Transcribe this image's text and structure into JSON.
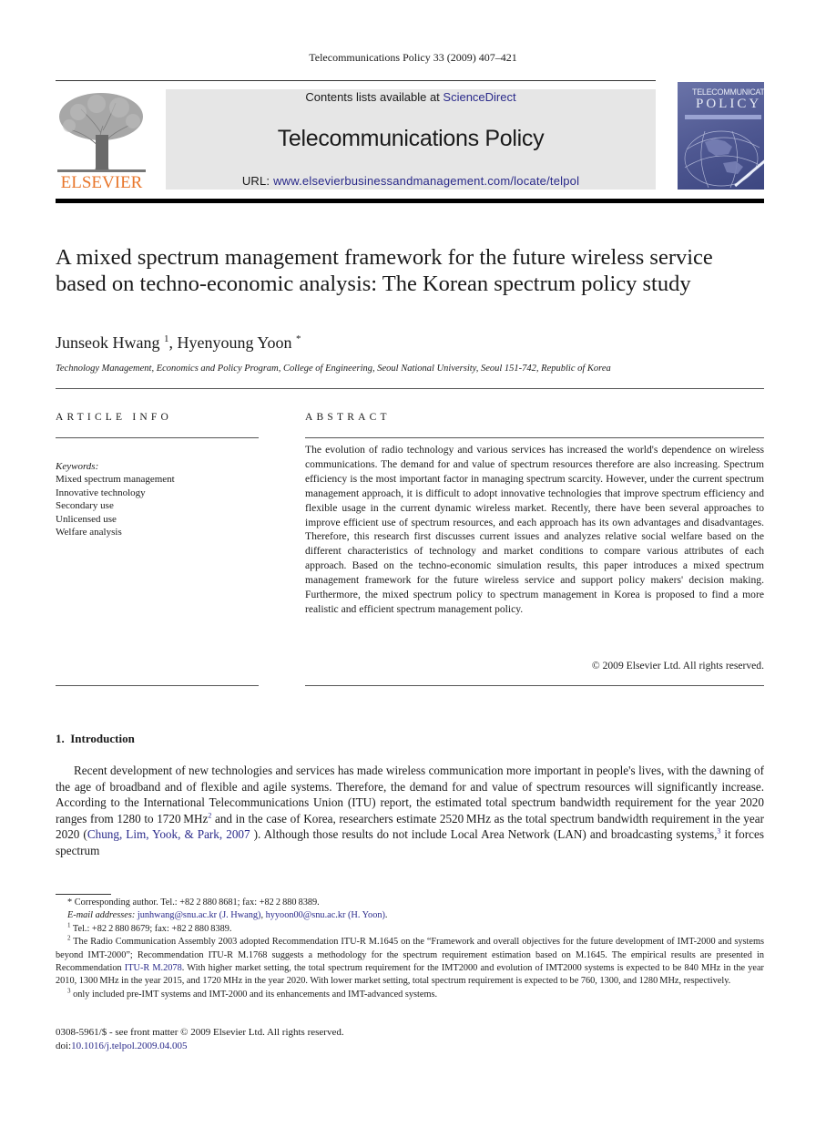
{
  "running_head": "Telecommunications Policy 33 (2009) 407–421",
  "masthead": {
    "contents_prefix": "Contents lists available at ",
    "contents_link": "ScienceDirect",
    "journal_name": "Telecommunications Policy",
    "url_prefix": "URL: ",
    "url": "www.elsevierbusinessandmanagement.com/locate/telpol",
    "publisher_logo_text": "ELSEVIER",
    "cover_title_line1": "TELECOMMUNICATIONS",
    "cover_title_line2": "POLICY"
  },
  "colors": {
    "link": "#2a2a8a",
    "elsevier_orange": "#e8762b",
    "masthead_gray": "#e6e6e6",
    "cover_blue": "#4e5791"
  },
  "article": {
    "title": "A mixed spectrum management framework for the future wireless service based on techno-economic analysis: The Korean spectrum policy study",
    "authors": [
      {
        "name": "Junseok Hwang",
        "mark": "1"
      },
      {
        "name": "Hyenyoung Yoon",
        "mark": "*"
      }
    ],
    "author_separator": ", ",
    "affiliation": "Technology Management, Economics and Policy Program, College of Engineering, Seoul National University, Seoul 151-742, Republic of Korea"
  },
  "article_info": {
    "heading": "ARTICLE INFO",
    "keywords_label": "Keywords:",
    "keywords": [
      "Mixed spectrum management",
      "Innovative technology",
      "Secondary use",
      "Unlicensed use",
      "Welfare analysis"
    ]
  },
  "abstract": {
    "heading": "ABSTRACT",
    "text": "The evolution of radio technology and various services has increased the world's dependence on wireless communications. The demand for and value of spectrum resources therefore are also increasing. Spectrum efficiency is the most important factor in managing spectrum scarcity. However, under the current spectrum management approach, it is difficult to adopt innovative technologies that improve spectrum efficiency and flexible usage in the current dynamic wireless market. Recently, there have been several approaches to improve efficient use of spectrum resources, and each approach has its own advantages and disadvantages. Therefore, this research first discusses current issues and analyzes relative social welfare based on the different characteristics of technology and market conditions to compare various attributes of each approach. Based on the techno-economic simulation results, this paper introduces a mixed spectrum management framework for the future wireless service and support policy makers' decision making. Furthermore, the mixed spectrum policy to spectrum management in Korea is proposed to find a more realistic and efficient spectrum management policy.",
    "copyright": "© 2009 Elsevier Ltd. All rights reserved."
  },
  "introduction": {
    "heading": "1. Introduction",
    "p1_a": "Recent development of new technologies and services has made wireless communication more important in people's lives, with the dawning of the age of broadband and of flexible and agile systems. Therefore, the demand for and value of spectrum resources will significantly increase. According to the International Telecommunications Union (ITU) report, the estimated total spectrum bandwidth requirement for the year 2020 ranges from 1280 to 1720 MHz",
    "p1_fn2": "2",
    "p1_b": " and in the case of Korea, researchers estimate 2520 MHz as the total spectrum bandwidth requirement in the year 2020 (",
    "p1_cite": "Chung, Lim, Yook, & Park, 2007",
    "p1_c": " ). Although those results do not include Local Area Network (LAN) and broadcasting systems,",
    "p1_fn3": "3",
    "p1_d": " it forces spectrum"
  },
  "footnotes": {
    "corresponding": "* Corresponding author. Tel.: +82 2 880 8681; fax: +82 2 880 8389.",
    "email_label": "E-mail addresses: ",
    "email1": "junhwang@snu.ac.kr (J. Hwang)",
    "email_sep": ", ",
    "email2": "hyyoon00@snu.ac.kr (H. Yoon)",
    "email_end": ".",
    "fn1_mark": "1",
    "fn1": " Tel.: +82 2 880 8679; fax: +82 2 880 8389.",
    "fn2_mark": "2",
    "fn2_a": " The Radio Communication Assembly 2003 adopted Recommendation ITU-R M.1645 on the “Framework and overall objectives for the future development of IMT-2000 and systems beyond IMT-2000”; Recommendation ITU-R M.1768 suggests a methodology for the spectrum requirement estimation based on M.1645. The empirical results are presented in Recommendation ",
    "fn2_link": "ITU-R M.2078",
    "fn2_b": ". With higher market setting, the total spectrum requirement for the IMT2000 and evolution of IMT2000 systems is expected to be 840 MHz in the year 2010, 1300 MHz in the year 2015, and 1720 MHz in the year 2020. With lower market setting, total spectrum requirement is expected to be 760, 1300, and 1280 MHz, respectively.",
    "fn3_mark": "3",
    "fn3": " only included pre-IMT systems and IMT-2000 and its enhancements and IMT-advanced systems."
  },
  "front_matter": {
    "issn_line": "0308-5961/$ - see front matter © 2009 Elsevier Ltd. All rights reserved.",
    "doi_prefix": "doi:",
    "doi": "10.1016/j.telpol.2009.04.005"
  }
}
